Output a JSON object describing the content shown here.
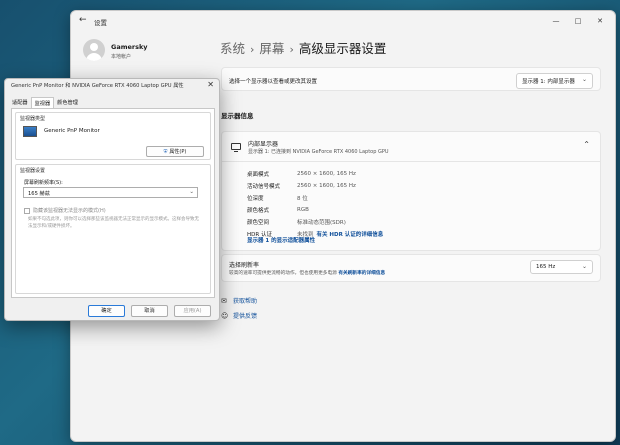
{
  "settings": {
    "app_title": "设置",
    "user": {
      "name": "Gamersky",
      "account": "本地帐户"
    },
    "breadcrumb": [
      "系统",
      "屏幕",
      "高级显示器设置"
    ],
    "select_display_label": "选择一个显示器以查看或更改其设置",
    "select_display_value": "显示器 1: 内部显示器",
    "display_info_heading": "显示器信息",
    "display": {
      "name": "内部显示器",
      "subtitle": "显示器 1: 已连接到 NVIDIA GeForce RTX 4060 Laptop GPU",
      "specs": [
        {
          "key": "桌面模式",
          "value": "2560 × 1600, 165 Hz"
        },
        {
          "key": "活动信号模式",
          "value": "2560 × 1600, 165 Hz"
        },
        {
          "key": "位深度",
          "value": "8 位"
        },
        {
          "key": "颜色格式",
          "value": "RGB"
        },
        {
          "key": "颜色空间",
          "value": "标准动态范围(SDR)"
        }
      ],
      "hdr_key": "HDR 认证",
      "hdr_value": "未找到",
      "hdr_link": "有关 HDR 认证的详细信息",
      "adapter_link": "显示器 1 的显示适配器属性"
    },
    "refresh": {
      "title": "选择刷新率",
      "description": "较高的速率可提供更流畅的动作，但也使用更多电源",
      "link": "有关刷新率的详细信息",
      "value": "165 Hz"
    },
    "help_links": [
      "获取帮助",
      "提供反馈"
    ]
  },
  "dialog": {
    "title": "Generic PnP Monitor 和 NVIDIA GeForce RTX 4060 Laptop GPU 属性",
    "tabs": [
      "适配器",
      "监视器",
      "颜色管理"
    ],
    "active_tab": 1,
    "monitor_type_group": "监视器类型",
    "monitor_name": "Generic PnP Monitor",
    "properties_button": "属性(P)",
    "monitor_settings_group": "监视器设置",
    "refresh_label": "屏幕刷新频率(S):",
    "refresh_value": "165 赫兹",
    "hide_modes_label": "隐藏该监视器无法显示的模式(H)",
    "warning_text": "如果不勾选此项，则你可以选择那些该监视器无法正常显示的显示模式。这样会导致无法显示和/或硬件损坏。",
    "buttons": {
      "ok": "确定",
      "cancel": "取消",
      "apply": "应用(A)"
    }
  }
}
